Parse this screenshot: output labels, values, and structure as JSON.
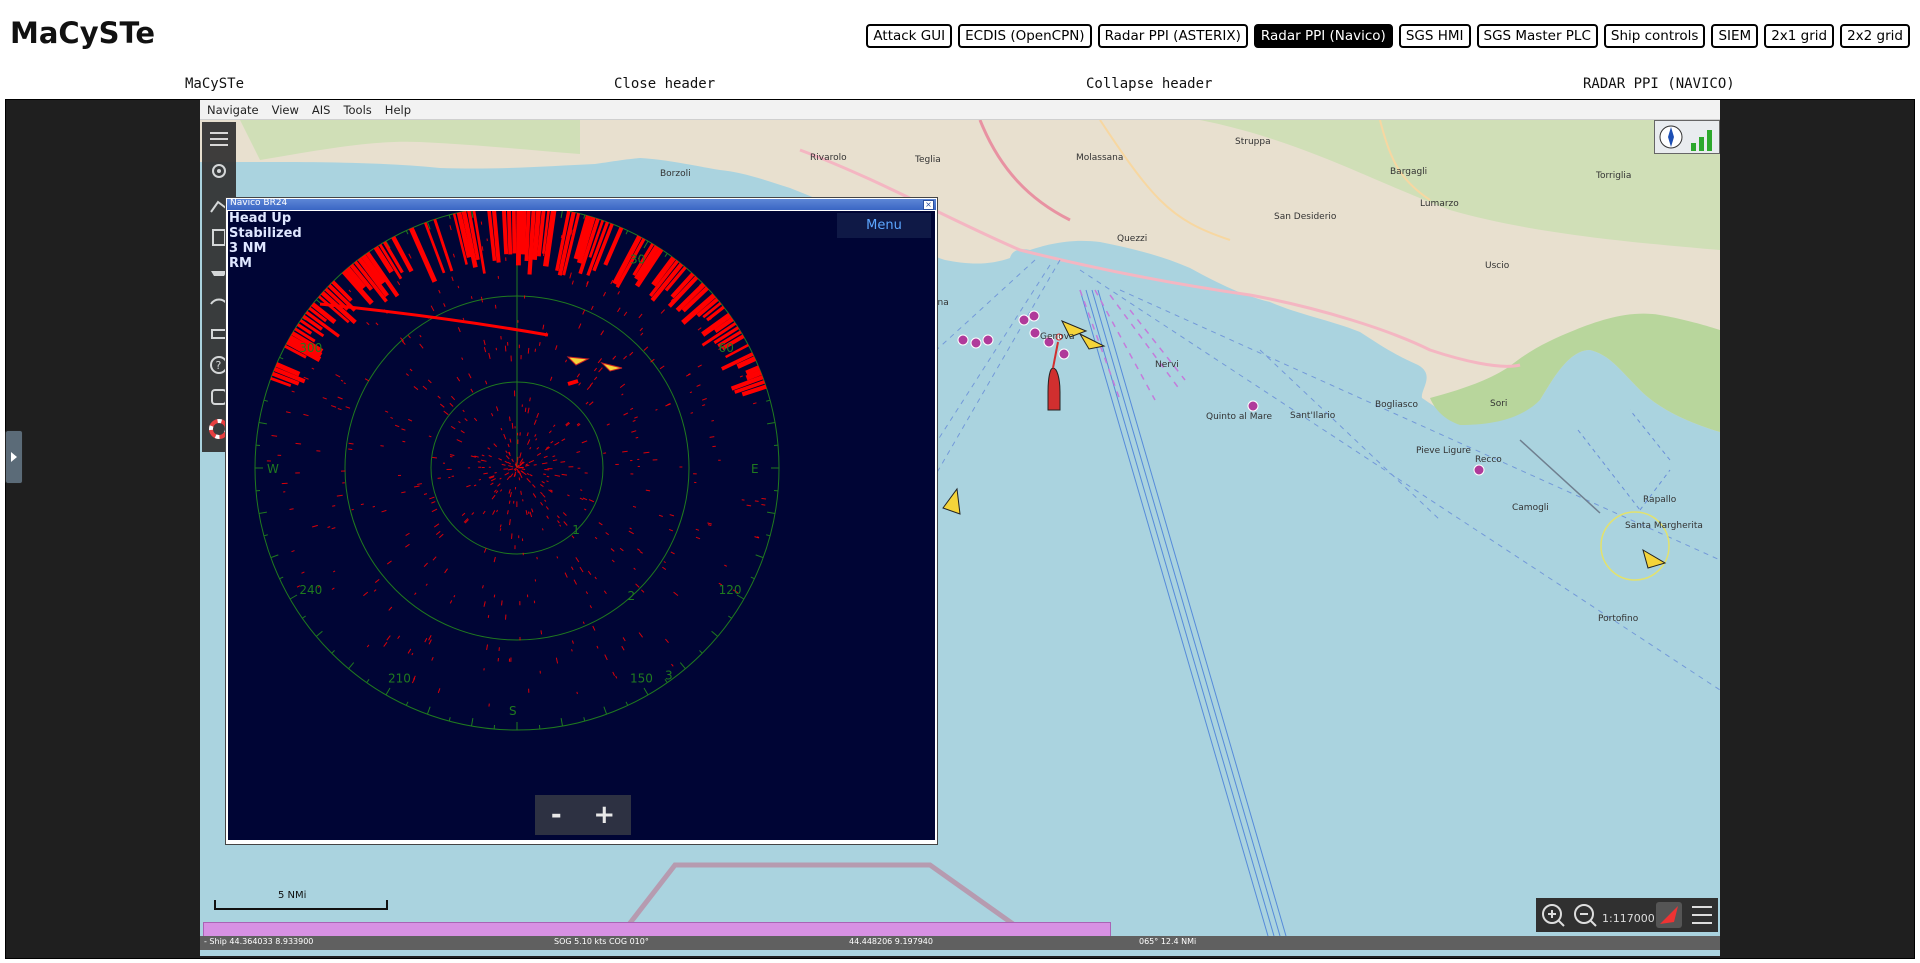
{
  "app": {
    "title": "MaCySTe"
  },
  "nav": {
    "buttons": [
      "Attack GUI",
      "ECDIS (OpenCPN)",
      "Radar PPI (ASTERIX)",
      "Radar PPI (Navico)",
      "SGS HMI",
      "SGS Master PLC",
      "Ship controls",
      "SIEM",
      "2x1 grid",
      "2x2 grid"
    ],
    "active": "Radar PPI (Navico)"
  },
  "header": {
    "name": "MaCySTe",
    "close": "Close header",
    "collapse": "Collapse header",
    "view": "RADAR PPI (NAVICO)"
  },
  "opencpn": {
    "menu": [
      "Navigate",
      "View",
      "AIS",
      "Tools",
      "Help"
    ],
    "scale": "1:117000",
    "scale_rule": "5 NMi",
    "status": {
      "ship": "- Ship 44.364033   8.933900",
      "sog": "SOG 5.10 kts   COG 010°",
      "cursor": "44.448206   9.197940",
      "brg": "065°   12.4 NMi"
    }
  },
  "map_labels": [
    "Genova",
    "Recco",
    "Rapallo",
    "Camogli",
    "Portofino",
    "Santa Margherita",
    "Nervi",
    "Sori",
    "Bogliasco",
    "Quinto al Mare",
    "Sant'Ilario",
    "Pieve Ligure",
    "Sampierdarena",
    "Rivarolo",
    "Borzoli",
    "San Desiderio",
    "Teglia",
    "Quezzi",
    "Molassana",
    "Struppa",
    "Torriglia",
    "Uscio",
    "Lumarzo",
    "Bargagli"
  ],
  "radar": {
    "window_title": "Navico BR24",
    "mode": "Head Up",
    "stabilization": "Stabilized",
    "range": "3 NM",
    "motion": "RM",
    "menu_label": "Menu",
    "zoom_out": "-",
    "zoom_in": "+",
    "bearing_labels": [
      {
        "angle": 30,
        "text": "30"
      },
      {
        "angle": 60,
        "text": "60"
      },
      {
        "angle": 90,
        "text": "E"
      },
      {
        "angle": 120,
        "text": "120"
      },
      {
        "angle": 150,
        "text": "150"
      },
      {
        "angle": 180,
        "text": "S"
      },
      {
        "angle": 210,
        "text": "210"
      },
      {
        "angle": 240,
        "text": "240"
      },
      {
        "angle": 270,
        "text": "W"
      },
      {
        "angle": 300,
        "text": "300"
      }
    ],
    "ring_labels": [
      "1",
      "2",
      "3"
    ]
  },
  "colors": {
    "sea": "#aad3df",
    "land": "#e8e0cf",
    "forest": "#b8d69c",
    "radar_bg": "#000535",
    "radar_echo": "#ff0000",
    "ring": "#1f7a1f",
    "active_nav": "#000000"
  }
}
